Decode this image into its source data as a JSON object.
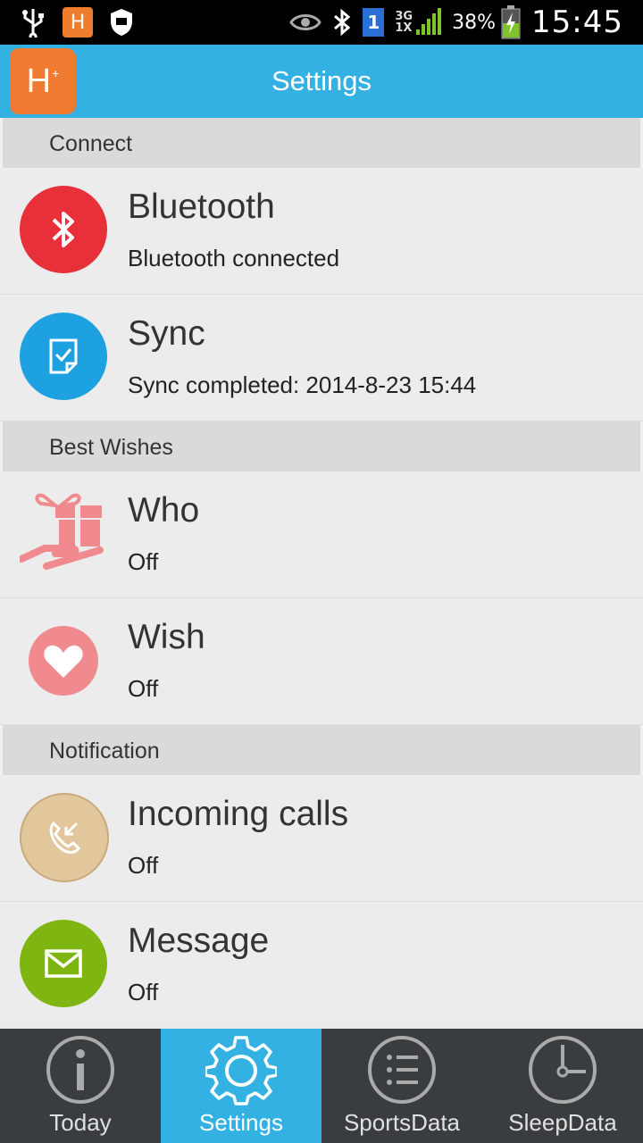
{
  "status_bar": {
    "badge_h": "H",
    "net_3g": "3G",
    "net_1x": "1X",
    "sim": "1",
    "battery": "38%",
    "time": "15:45"
  },
  "app_bar": {
    "logo": "H",
    "logo_sup": "+",
    "title": "Settings"
  },
  "sections": {
    "connect": {
      "header": "Connect",
      "bluetooth": {
        "title": "Bluetooth",
        "status": "Bluetooth connected",
        "color": "#e8303a"
      },
      "sync": {
        "title": "Sync",
        "status": "Sync completed: 2014-8-23 15:44",
        "color": "#1ea1e0"
      }
    },
    "best_wishes": {
      "header": "Best Wishes",
      "who": {
        "title": "Who",
        "status": "Off",
        "color": "#f08a8f"
      },
      "wish": {
        "title": "Wish",
        "status": "Off",
        "color": "#f08a8f"
      }
    },
    "notification": {
      "header": "Notification",
      "incoming_calls": {
        "title": "Incoming calls",
        "status": "Off",
        "color": "#e3c79c"
      },
      "message": {
        "title": "Message",
        "status": "Off",
        "color": "#7fb511"
      }
    }
  },
  "tabs": [
    {
      "label": "Today",
      "icon": "info-icon",
      "active": false
    },
    {
      "label": "Settings",
      "icon": "gear-icon",
      "active": true
    },
    {
      "label": "SportsData",
      "icon": "list-icon",
      "active": false
    },
    {
      "label": "SleepData",
      "icon": "clock-icon",
      "active": false
    }
  ]
}
